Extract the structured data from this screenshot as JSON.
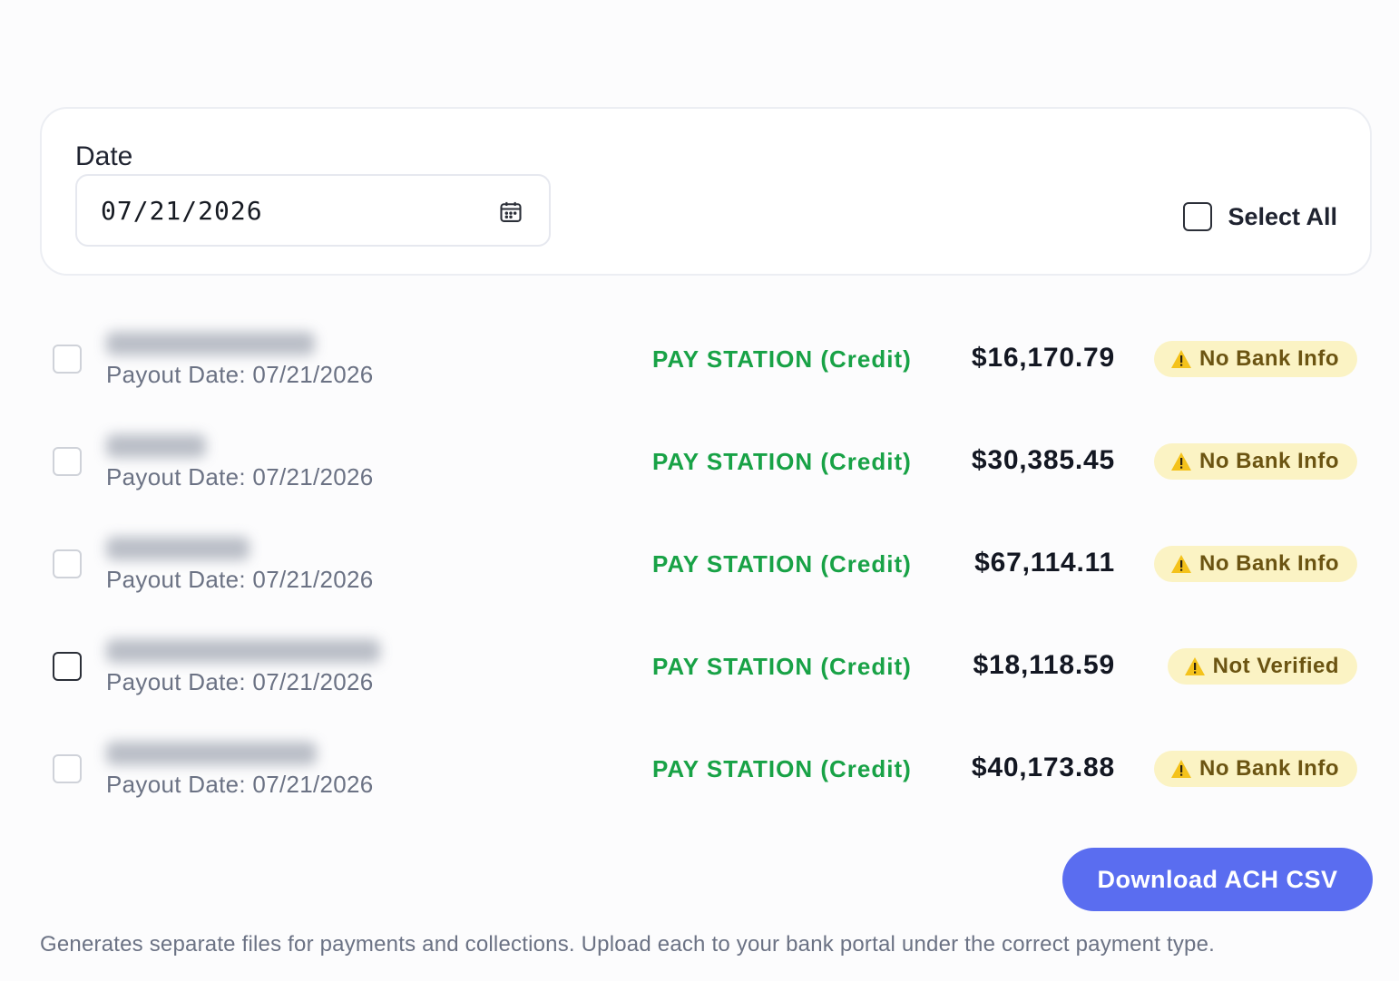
{
  "filters": {
    "date_label": "Date",
    "date_value": "07/21/2026",
    "calendar_icon": "calendar-icon",
    "select_all_label": "Select All",
    "select_all_checked": false
  },
  "payouts": [
    {
      "name": "",
      "name_blurred": true,
      "payout_date": "Payout Date: 07/21/2026",
      "method": "PAY STATION (Credit)",
      "amount": "$16,170.79",
      "status": "No Bank Info",
      "checked": false
    },
    {
      "name": "",
      "name_blurred": true,
      "payout_date": "Payout Date: 07/21/2026",
      "method": "PAY STATION (Credit)",
      "amount": "$30,385.45",
      "status": "No Bank Info",
      "checked": false
    },
    {
      "name": "",
      "name_blurred": true,
      "payout_date": "Payout Date: 07/21/2026",
      "method": "PAY STATION (Credit)",
      "amount": "$67,114.11",
      "status": "No Bank Info",
      "checked": false
    },
    {
      "name": "",
      "name_blurred": true,
      "payout_date": "Payout Date: 07/21/2026",
      "method": "PAY STATION (Credit)",
      "amount": "$18,118.59",
      "status": "Not Verified",
      "checked": false
    },
    {
      "name": "",
      "name_blurred": true,
      "payout_date": "Payout Date: 07/21/2026",
      "method": "PAY STATION (Credit)",
      "amount": "$40,173.88",
      "status": "No Bank Info",
      "checked": false
    }
  ],
  "actions": {
    "download_label": "Download ACH CSV"
  },
  "footnote": "Generates separate files for payments and collections. Upload each to your bank portal under the correct payment type.",
  "colors": {
    "method_green": "#18a246",
    "badge_bg": "#fbf3c4",
    "badge_text": "#6b5412",
    "button_blue": "#5a6df0"
  },
  "icons": {
    "status_icon": "warning-icon"
  }
}
